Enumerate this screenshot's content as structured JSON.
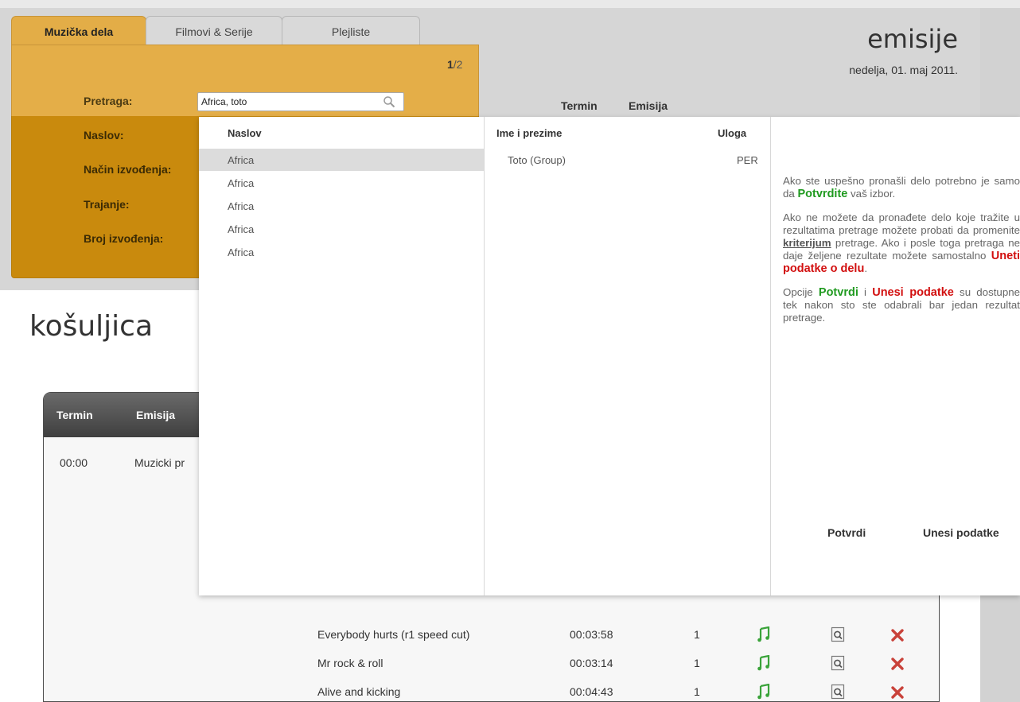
{
  "tabs": [
    {
      "label": "Muzička dela",
      "active": true
    },
    {
      "label": "Filmovi & Serije",
      "active": false
    },
    {
      "label": "Plejliste",
      "active": false
    }
  ],
  "panel": {
    "page_indicator_current": "1",
    "page_indicator_rest": "/2",
    "search_label": "Pretraga:",
    "search_value": "Africa, toto",
    "fields": [
      "Naslov:",
      "Način izvođenja:",
      "Trajanje:",
      "Broj izvođenja:"
    ]
  },
  "header": {
    "title": "emisije",
    "date": "nedelja, 01. maj 2011.",
    "col_termin": "Termin",
    "col_emisija": "Emisija"
  },
  "section_title": "košuljica",
  "table": {
    "col_termin": "Termin",
    "col_emisija": "Emisija",
    "first_row_time": "00:00",
    "first_row_show": "Muzicki pr",
    "songs": [
      {
        "title": "Everybody hurts (r1 speed cut)",
        "duration": "00:03:58",
        "count": "1"
      },
      {
        "title": "Mr rock & roll",
        "duration": "00:03:14",
        "count": "1"
      },
      {
        "title": "Alive and kicking",
        "duration": "00:04:43",
        "count": "1"
      }
    ]
  },
  "dropdown": {
    "col_naslov": "Naslov",
    "col_ime": "Ime i prezime",
    "col_uloga": "Uloga",
    "titles": [
      "Africa",
      "Africa",
      "Africa",
      "Africa",
      "Africa"
    ],
    "person_name": "Toto (Group)",
    "person_role": "PER",
    "help": {
      "p1_a": "Ako ste uspešno pronašli delo potrebno je samo da ",
      "p1_green": "Potvrdite",
      "p1_b": " vaš izbor.",
      "p2_a": "Ako ne možete da pronađete delo koje tražite u rezultatima pretrage možete probati da promenite ",
      "p2_link": "kriterijum",
      "p2_b": " pretrage. Ako i posle toga pretraga ne daje željene rezultate možete samostalno ",
      "p2_red": "Uneti podatke o delu",
      "p2_c": ".",
      "p3_a": "Opcije ",
      "p3_green": "Potvrdi",
      "p3_b": " i ",
      "p3_red": "Unesi podatke",
      "p3_c": " su dostupne tek nakon sto ste odabrali bar jedan rezultat pretrage."
    },
    "confirm_label": "Potvrdi",
    "enter_label": "Unesi podatke"
  },
  "colors": {
    "orange_light": "#e4ae48",
    "orange_dark": "#c98a0d",
    "green": "#1f9a1f",
    "red": "#d20f0f"
  }
}
